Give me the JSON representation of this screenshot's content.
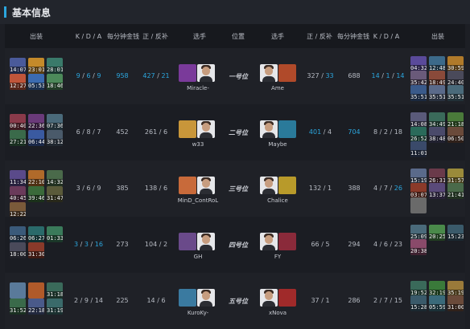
{
  "header": {
    "title": "基本信息"
  },
  "columns": {
    "left": {
      "items": "出装",
      "kda": "K / D / A",
      "gpm": "每分钟金钱",
      "lhdn": "正 / 反补",
      "player": "选手"
    },
    "position": "位置",
    "right": {
      "player": "选手",
      "lhdn": "正 / 反补",
      "gpm": "每分钟金钱",
      "kda": "K / D / A",
      "items": "出装"
    }
  },
  "rows": [
    {
      "position": "一号位",
      "left": {
        "name": "Miracle-",
        "kda": "9 / 6 / 9",
        "kda_blue": true,
        "gpm": "958",
        "gpm_blue": true,
        "lhdn": "427 / 21",
        "lhdn_blue": true,
        "items": [
          {
            "t": "14:07",
            "c": "#4a5a9a"
          },
          {
            "t": "23:01",
            "c": "#c48a2a"
          },
          {
            "t": "28:01",
            "c": "#3a7a6a"
          },
          {
            "t": "12:27",
            "c": "#c0553a"
          },
          {
            "t": "05:53",
            "c": "#3b6bb0"
          },
          {
            "t": "18:46",
            "c": "#4c8a5a"
          }
        ],
        "hero_color": "#7a3a9a"
      },
      "right": {
        "name": "Ame",
        "kda": "14 / 1 / 14",
        "kda_blue": true,
        "gpm": "688",
        "gpm_blue": false,
        "lhdn": "327 / 33",
        "lhdn_blue": "partial",
        "items": [
          {
            "t": "04:32",
            "c": "#5a4a9a"
          },
          {
            "t": "12:48",
            "c": "#3c6a8a"
          },
          {
            "t": "30:59",
            "c": "#b07a2a"
          },
          {
            "t": "35:42",
            "c": "#6a5a7a"
          },
          {
            "t": "18:49",
            "c": "#8a4a3a"
          },
          {
            "t": "24:40",
            "c": "#4a4a5a"
          },
          {
            "t": "35:51",
            "c": "#3a5a8a"
          },
          {
            "t": "35:51",
            "c": "#5a6a8a"
          },
          {
            "t": "35:51",
            "c": "#4a6a7a"
          }
        ],
        "hero_color": "#b04a2a"
      }
    },
    {
      "position": "二号位",
      "left": {
        "name": "w33",
        "kda": "6 / 8 / 7",
        "kda_blue": false,
        "gpm": "452",
        "gpm_blue": false,
        "lhdn": "261 / 6",
        "lhdn_blue": false,
        "items": [
          {
            "t": "00:40",
            "c": "#8a3a4a"
          },
          {
            "t": "22:36",
            "c": "#6a3a7a"
          },
          {
            "t": "07:36",
            "c": "#4a6a7a"
          },
          {
            "t": "27:21",
            "c": "#3a6a4a"
          },
          {
            "t": "06:44",
            "c": "#3a5aa0"
          },
          {
            "t": "38:12",
            "c": "#4a5a6a"
          }
        ],
        "hero_color": "#c8963a"
      },
      "right": {
        "name": "Maybe",
        "kda": "8 / 2 / 18",
        "kda_blue": false,
        "gpm": "704",
        "gpm_blue": true,
        "lhdn": "401 / 4",
        "lhdn_blue": "first",
        "items": [
          {
            "t": "14:08",
            "c": "#5a5a7a"
          },
          {
            "t": "34:49",
            "c": "#3a6a5a"
          },
          {
            "t": "21:18",
            "c": "#4a7a3a"
          },
          {
            "t": "26:52",
            "c": "#2a6a5a"
          },
          {
            "t": "38:48",
            "c": "#4a4a6a"
          },
          {
            "t": "06:50",
            "c": "#6a4a3a"
          },
          {
            "t": "11:01",
            "c": "#3a4a6a"
          }
        ],
        "hero_color": "#2a7a9a"
      }
    },
    {
      "position": "三号位",
      "left": {
        "name": "MinD_ContRoL",
        "kda": "3 / 6 / 9",
        "kda_blue": false,
        "gpm": "385",
        "gpm_blue": false,
        "lhdn": "138 / 6",
        "lhdn_blue": false,
        "items": [
          {
            "t": "11:34",
            "c": "#5a4a8a"
          },
          {
            "t": "22:10",
            "c": "#b06a2a"
          },
          {
            "t": "14:32",
            "c": "#4a6a4a"
          },
          {
            "t": "40:45",
            "c": "#6a3a5a"
          },
          {
            "t": "39:46",
            "c": "#3a6a3a"
          },
          {
            "t": "31:47",
            "c": "#5a5a3a"
          },
          {
            "t": "12:22",
            "c": "#7a5a3a"
          }
        ],
        "hero_color": "#c86a3a"
      },
      "right": {
        "name": "Chalice",
        "kda": "4 / 7 / 26",
        "kda_blue": "last",
        "gpm": "388",
        "gpm_blue": false,
        "lhdn": "132 / 1",
        "lhdn_blue": false,
        "items": [
          {
            "t": "15:19",
            "c": "#5a6a8a"
          },
          {
            "t": "26:31",
            "c": "#6a3a4a"
          },
          {
            "t": "31:57",
            "c": "#9a8a3a"
          },
          {
            "t": "03:07",
            "c": "#8a3a2a"
          },
          {
            "t": "13:37",
            "c": "#5a4a7a"
          },
          {
            "t": "21:41",
            "c": "#4a6a4a"
          },
          {
            "t": "",
            "c": "#6a6a6a"
          }
        ],
        "hero_color": "#b89a2a"
      }
    },
    {
      "position": "四号位",
      "left": {
        "name": "GH",
        "kda": "3 / 3 / 16",
        "kda_blue": true,
        "gpm": "273",
        "gpm_blue": false,
        "lhdn": "104 / 2",
        "lhdn_blue": false,
        "items": [
          {
            "t": "06:26",
            "c": "#3a5a7a"
          },
          {
            "t": "06:27",
            "c": "#2a6a6a"
          },
          {
            "t": "01:33",
            "c": "#3a7a5a"
          },
          {
            "t": "18:00",
            "c": "#4a4a5a"
          },
          {
            "t": "31:30",
            "c": "#8a3a2a"
          }
        ],
        "hero_color": "#6a4a8a"
      },
      "right": {
        "name": "FY",
        "kda": "4 / 6 / 23",
        "kda_blue": false,
        "gpm": "294",
        "gpm_blue": false,
        "lhdn": "66 / 5",
        "lhdn_blue": false,
        "items": [
          {
            "t": "25:09",
            "c": "#4a6a7a"
          },
          {
            "t": "20:25",
            "c": "#4a8a4a"
          },
          {
            "t": "15:23",
            "c": "#3a5a6a"
          },
          {
            "t": "20:38",
            "c": "#8a4a6a"
          }
        ],
        "hero_color": "#8a2a3a"
      }
    },
    {
      "position": "五号位",
      "left": {
        "name": "KuroKy-",
        "kda": "2 / 9 / 14",
        "kda_blue": false,
        "gpm": "225",
        "gpm_blue": false,
        "lhdn": "14 / 6",
        "lhdn_blue": false,
        "items": [
          {
            "t": "",
            "c": "#5a7a9a"
          },
          {
            "t": "",
            "c": "#b05a2a"
          },
          {
            "t": "31:18",
            "c": "#3a6a5a"
          },
          {
            "t": "31:52",
            "c": "#3a6a4a"
          },
          {
            "t": "22:18",
            "c": "#4a5a8a"
          },
          {
            "t": "31:19",
            "c": "#3a6a6a"
          }
        ],
        "hero_color": "#3a7aa0"
      },
      "right": {
        "name": "xNova",
        "kda": "2 / 7 / 15",
        "kda_blue": false,
        "gpm": "286",
        "gpm_blue": false,
        "lhdn": "37 / 1",
        "lhdn_blue": false,
        "items": [
          {
            "t": "19:52",
            "c": "#3a6a5a"
          },
          {
            "t": "32:19",
            "c": "#3a7a3a"
          },
          {
            "t": "35:19",
            "c": "#9a7a3a"
          },
          {
            "t": "15:28",
            "c": "#3a5a6a"
          },
          {
            "t": "05:59",
            "c": "#3a6a7a"
          },
          {
            "t": "31:00",
            "c": "#6a4a3a"
          }
        ],
        "hero_color": "#a02a2a"
      }
    }
  ]
}
